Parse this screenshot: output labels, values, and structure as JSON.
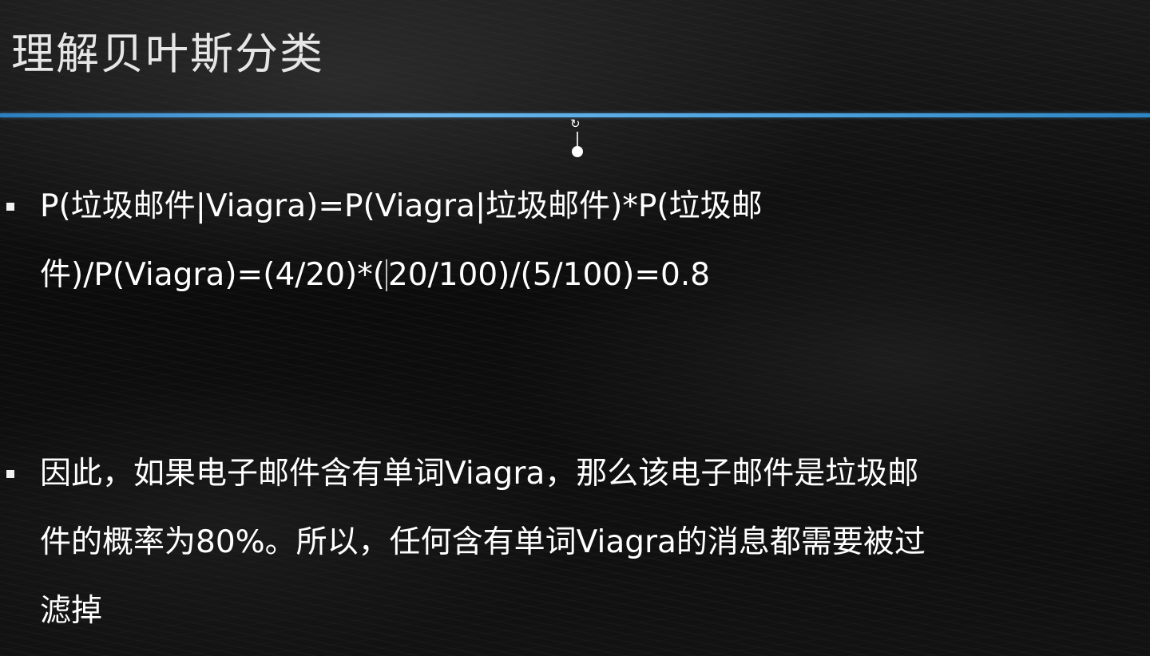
{
  "slide": {
    "title": "理解贝叶斯分类",
    "accent_color": "#4aa2de",
    "background_color": "#101010",
    "text_color": "#ffffff"
  },
  "bullets": [
    {
      "lines": [
        "P(垃圾邮件|Viagra)=P(Viagra|垃圾邮件)*P(垃圾邮",
        "件)/P(Viagra)=(4/20)*(",
        "20/100)/(5/100)=0.8"
      ]
    },
    {
      "lines": [
        "因此，如果电子邮件含有单词Viagra，那么该电子邮件是垃圾邮",
        "件的概率为80%。所以，任何含有单词Viagra的消息都需要被过",
        "滤掉"
      ]
    }
  ],
  "icons": {
    "rotate_handle": "rotate-icon"
  }
}
